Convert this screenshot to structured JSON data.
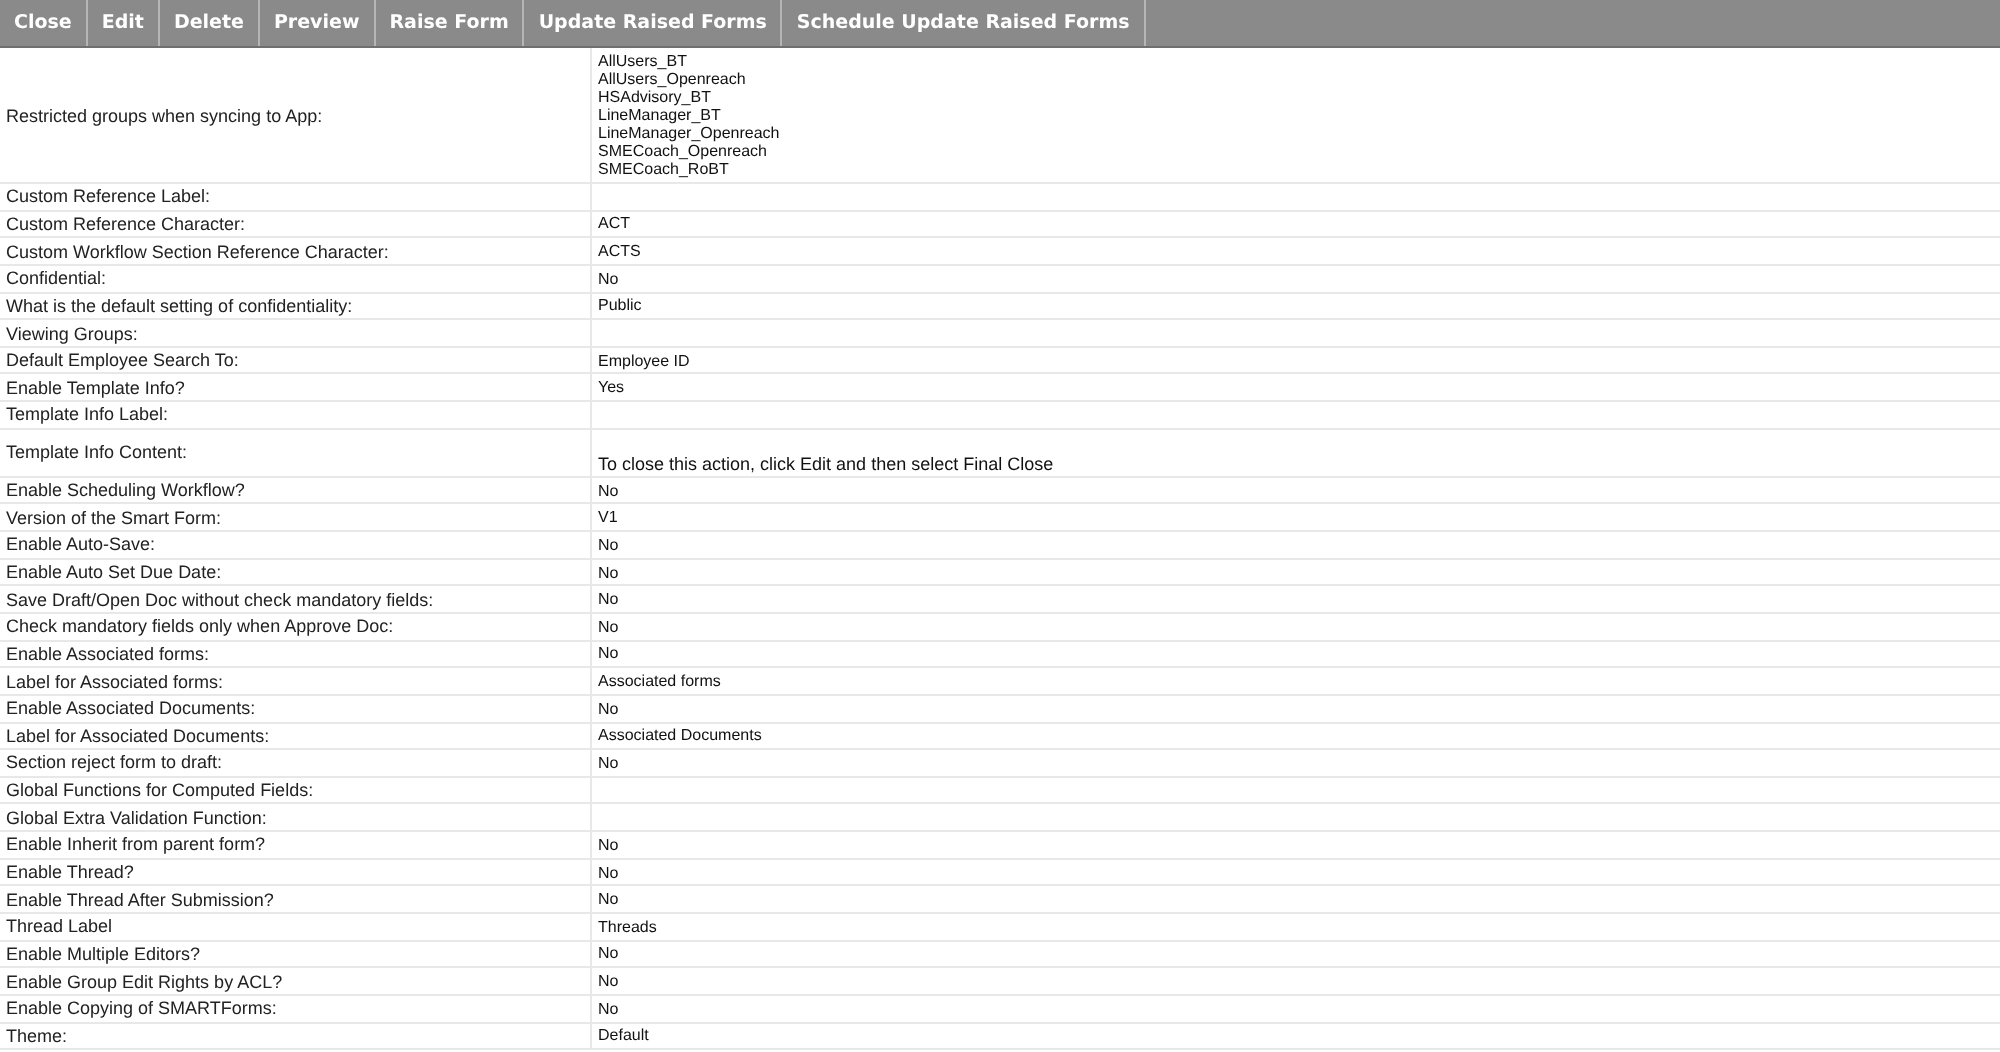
{
  "toolbar": [
    "Close",
    "Edit",
    "Delete",
    "Preview",
    "Raise Form",
    "Update Raised Forms",
    "Schedule Update Raised Forms"
  ],
  "rows": [
    {
      "label": "Restricted groups when syncing to App:",
      "kind": "list",
      "values": [
        "AllUsers_BT",
        "AllUsers_Openreach",
        "HSAdvisory_BT",
        "LineManager_BT",
        "LineManager_Openreach",
        "SMECoach_Openreach",
        "SMECoach_RoBT"
      ]
    },
    {
      "label": "Custom Reference Label:",
      "kind": "text"
    },
    {
      "label": "Custom Reference Character:",
      "kind": "text",
      "value": "ACT"
    },
    {
      "label": "Custom Workflow Section Reference Character:",
      "kind": "text",
      "value": "ACTS"
    },
    {
      "label": "Confidential:",
      "kind": "text",
      "value": "No"
    },
    {
      "label": "What is the default setting of confidentiality:",
      "kind": "text",
      "value": "Public"
    },
    {
      "label": "Viewing Groups:",
      "kind": "text"
    },
    {
      "label": "Default Employee Search To:",
      "kind": "text",
      "value": "Employee ID"
    },
    {
      "label": "Enable Template Info?",
      "kind": "text",
      "value": "Yes"
    },
    {
      "label": "Template Info Label:",
      "kind": "text"
    },
    {
      "label": "Template Info Content:",
      "kind": "note",
      "value": "To close this action, click Edit and then select Final Close"
    },
    {
      "label": "Enable Scheduling Workflow?",
      "kind": "text",
      "value": "No"
    },
    {
      "label": "Version of the Smart Form:",
      "kind": "text",
      "value": "V1"
    },
    {
      "label": "Enable Auto-Save:",
      "kind": "text",
      "value": "No"
    },
    {
      "label": "Enable Auto Set Due Date:",
      "kind": "text",
      "value": "No"
    },
    {
      "label": "Save Draft/Open Doc without check mandatory fields:",
      "kind": "text",
      "value": "No"
    },
    {
      "label": "Check mandatory fields only when Approve Doc:",
      "kind": "text",
      "value": "No"
    },
    {
      "label": "Enable Associated forms:",
      "kind": "text",
      "value": "No"
    },
    {
      "label": "Label for Associated forms:",
      "kind": "text",
      "value": "Associated forms"
    },
    {
      "label": "Enable Associated Documents:",
      "kind": "text",
      "value": "No"
    },
    {
      "label": "Label for Associated Documents:",
      "kind": "text",
      "value": "Associated Documents"
    },
    {
      "label": "Section reject form to draft:",
      "kind": "text",
      "value": "No"
    },
    {
      "label": "Global Functions for Computed Fields:",
      "kind": "text"
    },
    {
      "label": "Global Extra Validation Function:",
      "kind": "text"
    },
    {
      "label": "Enable Inherit from parent form?",
      "kind": "text",
      "value": "No"
    },
    {
      "label": "Enable Thread?",
      "kind": "text",
      "value": "No"
    },
    {
      "label": "Enable Thread After Submission?",
      "kind": "text",
      "value": "No"
    },
    {
      "label": "Thread Label",
      "kind": "text",
      "value": "Threads"
    },
    {
      "label": "Enable Multiple Editors?",
      "kind": "text",
      "value": "No"
    },
    {
      "label": "Enable Group Edit Rights by ACL?",
      "kind": "text",
      "value": "No"
    },
    {
      "label": "Enable Copying of SMARTForms:",
      "kind": "text",
      "value": "No"
    },
    {
      "label": "Theme:",
      "kind": "text",
      "value": "Default"
    }
  ]
}
